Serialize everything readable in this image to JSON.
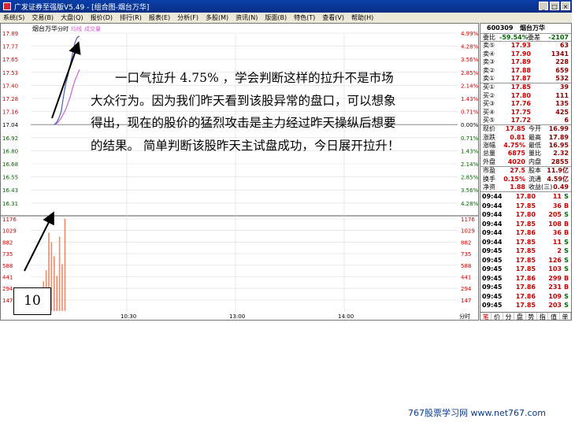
{
  "window": {
    "title": "广发证券至强版V5.49 - [组合图-烟台万华]"
  },
  "menu": [
    "系统(S)",
    "交易(B)",
    "大盘(Q)",
    "报价(D)",
    "排行(R)",
    "报表(E)",
    "分析(F)",
    "多股(M)",
    "资讯(N)",
    "版面(B)",
    "特色(T)",
    "查看(V)",
    "帮助(H)"
  ],
  "chart": {
    "stock_name": "烟台万华",
    "legend": [
      "分时",
      "均线",
      "成交量"
    ],
    "price_labels": [
      "17.89",
      "17.77",
      "17.65",
      "17.53",
      "17.40",
      "17.28",
      "17.16",
      "17.04",
      "16.92",
      "16.80",
      "16.68",
      "16.55",
      "16.43",
      "16.31"
    ],
    "pct_labels": [
      "4.99%",
      "4.28%",
      "3.56%",
      "2.85%",
      "2.14%",
      "1.43%",
      "0.71%",
      "0.00%",
      "0.71%",
      "1.43%",
      "2.14%",
      "2.85%",
      "3.56%",
      "4.28%"
    ],
    "vol_labels": [
      "1176",
      "1029",
      "882",
      "735",
      "588",
      "441",
      "294",
      "147"
    ],
    "time_labels": [
      "10:30",
      "13:00",
      "14:00"
    ],
    "right_bottom_label": "分时",
    "price_series": [
      17.04,
      17.06,
      17.1,
      17.16,
      17.3,
      17.42,
      17.5,
      17.6,
      17.7,
      17.8,
      17.85,
      17.86
    ],
    "avg_series": [
      17.04,
      17.05,
      17.07,
      17.1,
      17.14,
      17.18,
      17.24,
      17.3,
      17.38,
      17.45,
      17.5,
      17.55
    ],
    "volume_series": [
      200,
      380,
      520,
      1000,
      880,
      700,
      450,
      950,
      600,
      1180
    ],
    "colors": {
      "price": "#4a5ab8",
      "avg": "#d060d0",
      "volume": "#f28a6a"
    }
  },
  "caption": "一口气拉升 4.75% ，学会判断这样的拉升不是市场大众行为。因为我们昨天看到该股异常的盘口，可以想象得出，现在的股价的猛烈攻击是主力经过昨天操纵后想要的结果。 简单判断该股昨天主试盘成功，今日展开拉升！",
  "box_label": "10",
  "panel": {
    "code": "600309",
    "name": "烟台万华",
    "ratio_label": "委比",
    "ratio_value": "-59.54%",
    "diff_label": "委差",
    "diff_value": "-2107",
    "sells": [
      {
        "label": "卖⑤",
        "price": "17.93",
        "vol": "63"
      },
      {
        "label": "卖④",
        "price": "17.90",
        "vol": "1341"
      },
      {
        "label": "卖③",
        "price": "17.89",
        "vol": "228"
      },
      {
        "label": "卖②",
        "price": "17.88",
        "vol": "659"
      },
      {
        "label": "卖①",
        "price": "17.87",
        "vol": "532"
      }
    ],
    "buys": [
      {
        "label": "买①",
        "price": "17.85",
        "vol": "39"
      },
      {
        "label": "买②",
        "price": "17.80",
        "vol": "111"
      },
      {
        "label": "买③",
        "price": "17.76",
        "vol": "135"
      },
      {
        "label": "买④",
        "price": "17.75",
        "vol": "425"
      },
      {
        "label": "买⑤",
        "price": "17.72",
        "vol": "6"
      }
    ],
    "stats": [
      [
        "现价",
        "17.85",
        "今开",
        "16.99"
      ],
      [
        "涨跌",
        "0.81",
        "最高",
        "17.89"
      ],
      [
        "涨幅",
        "4.75%",
        "最低",
        "16.95"
      ],
      [
        "总量",
        "6875",
        "量比",
        "2.32"
      ],
      [
        "外盘",
        "4020",
        "内盘",
        "2855"
      ]
    ],
    "stats2": [
      [
        "市盈",
        "27.5",
        "股本",
        "11.9亿"
      ],
      [
        "换手",
        "0.15%",
        "流通",
        "4.59亿"
      ],
      [
        "净资",
        "1.88",
        "收益(三)",
        "0.49"
      ]
    ],
    "ticks": [
      [
        "09:44",
        "17.80",
        "11",
        "S"
      ],
      [
        "09:44",
        "17.85",
        "36",
        "B"
      ],
      [
        "09:44",
        "17.80",
        "205",
        "S"
      ],
      [
        "09:44",
        "17.85",
        "108",
        "B"
      ],
      [
        "09:44",
        "17.86",
        "36",
        "B"
      ],
      [
        "09:44",
        "17.85",
        "11",
        "S"
      ],
      [
        "09:45",
        "17.85",
        "2",
        "S"
      ],
      [
        "09:45",
        "17.85",
        "126",
        "S"
      ],
      [
        "09:45",
        "17.85",
        "103",
        "S"
      ],
      [
        "09:45",
        "17.86",
        "299",
        "B"
      ],
      [
        "09:45",
        "17.86",
        "231",
        "B"
      ],
      [
        "09:45",
        "17.86",
        "109",
        "S"
      ],
      [
        "09:45",
        "17.85",
        "203",
        "S"
      ]
    ],
    "tabs": [
      "笔",
      "价",
      "分",
      "盘",
      "势",
      "指",
      "值",
      "单"
    ]
  },
  "footer": "767股票学习网 www.net767.com"
}
